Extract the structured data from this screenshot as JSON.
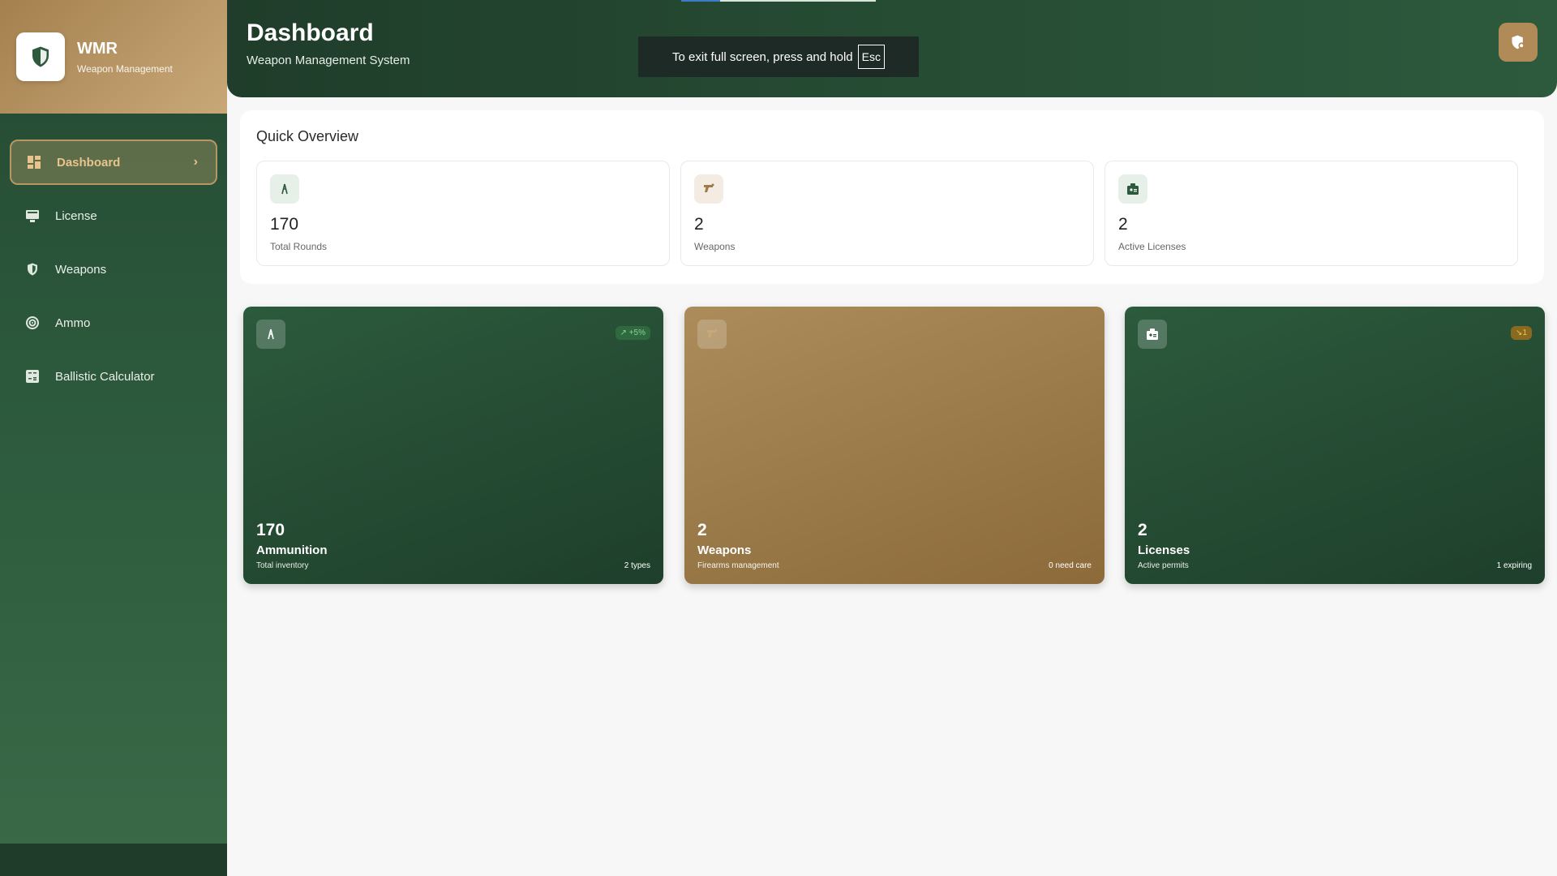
{
  "brand": {
    "title": "WMR",
    "subtitle": "Weapon Management"
  },
  "nav": {
    "items": [
      {
        "label": "Dashboard",
        "icon": "dashboard-icon",
        "active": true
      },
      {
        "label": "License",
        "icon": "license-icon"
      },
      {
        "label": "Weapons",
        "icon": "shield-icon"
      },
      {
        "label": "Ammo",
        "icon": "target-icon"
      },
      {
        "label": "Ballistic Calculator",
        "icon": "calculator-icon"
      }
    ]
  },
  "header": {
    "title": "Dashboard",
    "subtitle": "Weapon Management System",
    "fullscreen_hint": "To exit full screen, press and hold",
    "fullscreen_key": "Esc",
    "action_icon": "shield-settings-icon"
  },
  "overview": {
    "title": "Quick Overview",
    "cards": [
      {
        "value": "170",
        "label": "Total Rounds",
        "icon": "ammo-icon"
      },
      {
        "value": "2",
        "label": "Weapons",
        "icon": "gun-icon"
      },
      {
        "value": "2",
        "label": "Active Licenses",
        "icon": "badge-icon"
      }
    ]
  },
  "stats": [
    {
      "value": "170",
      "title": "Ammunition",
      "subtitle": "Total inventory",
      "right": "2 types",
      "badge": "+5%",
      "badge_icon": "trend-up-icon",
      "icon": "ammo-icon"
    },
    {
      "value": "2",
      "title": "Weapons",
      "subtitle": "Firearms management",
      "right": "0 need care",
      "icon": "gun-icon"
    },
    {
      "value": "2",
      "title": "Licenses",
      "subtitle": "Active permits",
      "right": "1 expiring",
      "badge": "1",
      "badge_icon": "trend-down-icon",
      "icon": "badge-icon"
    }
  ],
  "colors": {
    "primary": "#2c5a3c",
    "accent": "#b08a57",
    "background": "#f7f7f7"
  }
}
